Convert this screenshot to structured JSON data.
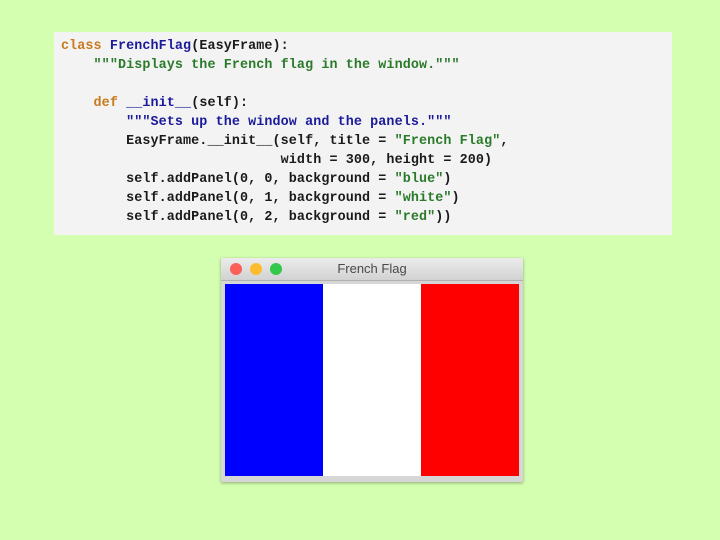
{
  "code": {
    "lines": [
      [
        {
          "t": "class ",
          "c": "kw"
        },
        {
          "t": "FrenchFlag",
          "c": "cls"
        },
        {
          "t": "(EasyFrame):",
          "c": "plain"
        }
      ],
      [
        {
          "t": "    \"\"\"Displays the French flag in the window.\"\"\"",
          "c": "str"
        }
      ],
      [
        {
          "t": "",
          "c": "plain"
        }
      ],
      [
        {
          "t": "    def ",
          "c": "kw"
        },
        {
          "t": "__init__",
          "c": "cls"
        },
        {
          "t": "(self):",
          "c": "plain"
        }
      ],
      [
        {
          "t": "        \"\"\"Sets up the window and the panels.\"\"\"",
          "c": "doc-blue"
        }
      ],
      [
        {
          "t": "        EasyFrame.__init__(self, title = ",
          "c": "plain"
        },
        {
          "t": "\"French Flag\"",
          "c": "str"
        },
        {
          "t": ",",
          "c": "plain"
        }
      ],
      [
        {
          "t": "                           width = 300, height = 200)",
          "c": "plain"
        }
      ],
      [
        {
          "t": "        self.addPanel(0, 0, background = ",
          "c": "plain"
        },
        {
          "t": "\"blue\"",
          "c": "str"
        },
        {
          "t": ")",
          "c": "plain"
        }
      ],
      [
        {
          "t": "        self.addPanel(0, 1, background = ",
          "c": "plain"
        },
        {
          "t": "\"white\"",
          "c": "str"
        },
        {
          "t": ")",
          "c": "plain"
        }
      ],
      [
        {
          "t": "        self.addPanel(0, 2, background = ",
          "c": "plain"
        },
        {
          "t": "\"red\"",
          "c": "str"
        },
        {
          "t": "))",
          "c": "plain"
        }
      ]
    ]
  },
  "window": {
    "title": "French Flag",
    "buttons": [
      "close",
      "minimize",
      "maximize"
    ],
    "panels": [
      {
        "name": "blue",
        "color": "#0000ff"
      },
      {
        "name": "white",
        "color": "#ffffff"
      },
      {
        "name": "red",
        "color": "#ff0000"
      }
    ]
  }
}
